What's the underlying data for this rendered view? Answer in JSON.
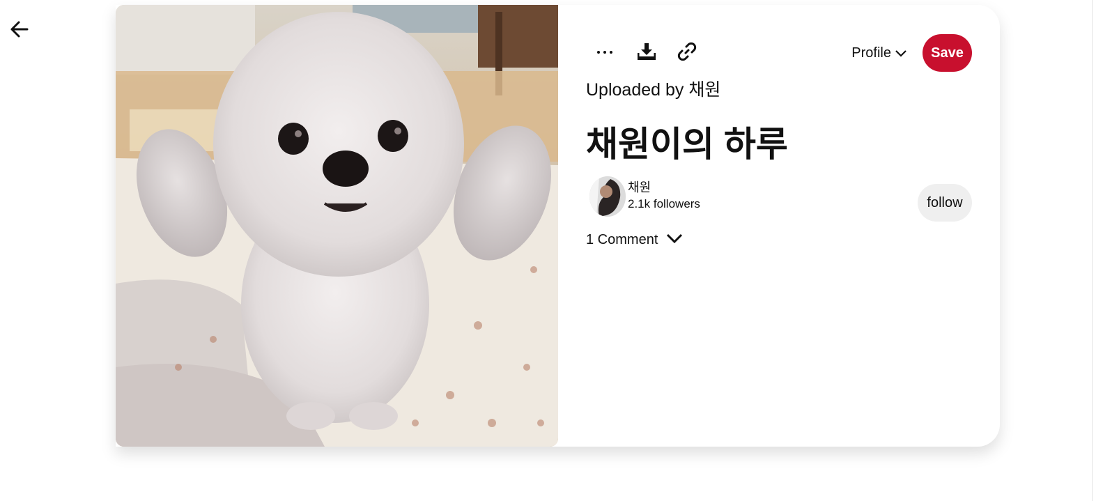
{
  "nav": {
    "back_icon": "arrow-left-icon"
  },
  "pin": {
    "image_description_icon": "photo",
    "toolbar": {
      "more_icon": "more-horizontal-icon",
      "more_label": "···",
      "download_icon": "download-icon",
      "link_icon": "link-icon",
      "profile_label": "Profile",
      "profile_icon": "chevron-down-icon",
      "save_label": "Save"
    },
    "uploaded_by": "Uploaded by 채원",
    "title": "채원이의 하루",
    "creator": {
      "name": "채원",
      "followers": "2.1k followers",
      "follow_label": "follow"
    },
    "comments": {
      "label": "1 Comment",
      "toggle_icon": "chevron-down-icon"
    }
  },
  "colors": {
    "save_button": "#c8102e",
    "follow_button": "#efefef",
    "text": "#111111"
  }
}
